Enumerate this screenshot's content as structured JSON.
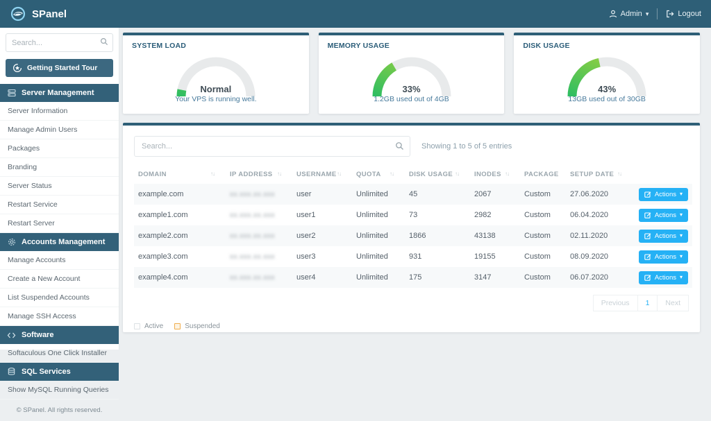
{
  "topbar": {
    "brand": "SPanel",
    "admin_label": "Admin",
    "logout_label": "Logout"
  },
  "sidebar": {
    "search_placeholder": "Search...",
    "tour_button_label": "Getting Started Tour",
    "sections": [
      {
        "label": "Server Management",
        "icon": "server-icon",
        "items": [
          "Server Information",
          "Manage Admin Users",
          "Packages",
          "Branding",
          "Server Status",
          "Restart Service",
          "Restart Server"
        ]
      },
      {
        "label": "Accounts Management",
        "icon": "gear-icon",
        "items": [
          "Manage Accounts",
          "Create a New Account",
          "List Suspended Accounts",
          "Manage SSH Access"
        ]
      },
      {
        "label": "Software",
        "icon": "code-icon",
        "items": [
          "Softaculous One Click Installer"
        ]
      },
      {
        "label": "SQL Services",
        "icon": "database-icon",
        "items": [
          "Show MySQL Running Queries"
        ]
      }
    ],
    "footer": "© SPanel. All rights reserved."
  },
  "cards": [
    {
      "title": "SYSTEM LOAD",
      "center": "Normal",
      "sub": "Your VPS is running well.",
      "percent": 6
    },
    {
      "title": "MEMORY USAGE",
      "center": "33%",
      "sub": "1.2GB used out of 4GB",
      "percent": 33
    },
    {
      "title": "DISK USAGE",
      "center": "43%",
      "sub": "13GB used out of 30GB",
      "percent": 43
    }
  ],
  "chart_data": [
    {
      "type": "gauge",
      "title": "SYSTEM LOAD",
      "value_label": "Normal",
      "subtitle": "Your VPS is running well.",
      "percent": 6
    },
    {
      "type": "gauge",
      "title": "MEMORY USAGE",
      "value_label": "33%",
      "subtitle": "1.2GB used out of 4GB",
      "percent": 33
    },
    {
      "type": "gauge",
      "title": "DISK USAGE",
      "value_label": "43%",
      "subtitle": "13GB used out of 30GB",
      "percent": 43
    }
  ],
  "table": {
    "search_placeholder": "Search...",
    "showing_text": "Showing 1 to 5 of 5 entries",
    "actions_label": "Actions",
    "columns": [
      {
        "label": "DOMAIN",
        "sortable": true,
        "width": 132
      },
      {
        "label": "IP ADDRESS",
        "sortable": true,
        "width": 96
      },
      {
        "label": "USERNAME",
        "sortable": true,
        "width": 86
      },
      {
        "label": "QUOTA",
        "sortable": true,
        "width": 76
      },
      {
        "label": "DISK USAGE",
        "sortable": true,
        "width": 94
      },
      {
        "label": "INODES",
        "sortable": true,
        "width": 72
      },
      {
        "label": "PACKAGE",
        "sortable": false,
        "width": 66
      },
      {
        "label": "SETUP DATE",
        "sortable": true,
        "width": 96
      },
      {
        "label": "",
        "sortable": false,
        "width": 86
      }
    ],
    "rows": [
      {
        "domain": "example.com",
        "ip_masked": "xx.xxx.xx.xxx",
        "username": "user",
        "quota": "Unlimited",
        "disk_usage": "45",
        "inodes": "2067",
        "package": "Custom",
        "setup_date": "27.06.2020"
      },
      {
        "domain": "example1.com",
        "ip_masked": "xx.xxx.xx.xxx",
        "username": "user1",
        "quota": "Unlimited",
        "disk_usage": "73",
        "inodes": "2982",
        "package": "Custom",
        "setup_date": "06.04.2020"
      },
      {
        "domain": "example2.com",
        "ip_masked": "xx.xxx.xx.xxx",
        "username": "user2",
        "quota": "Unlimited",
        "disk_usage": "1866",
        "inodes": "43138",
        "package": "Custom",
        "setup_date": "02.11.2020"
      },
      {
        "domain": "example3.com",
        "ip_masked": "xx.xxx.xx.xxx",
        "username": "user3",
        "quota": "Unlimited",
        "disk_usage": "931",
        "inodes": "19155",
        "package": "Custom",
        "setup_date": "08.09.2020"
      },
      {
        "domain": "example4.com",
        "ip_masked": "xx.xxx.xx.xxx",
        "username": "user4",
        "quota": "Unlimited",
        "disk_usage": "175",
        "inodes": "3147",
        "package": "Custom",
        "setup_date": "06.07.2020"
      }
    ],
    "pagination": {
      "previous": "Previous",
      "page": "1",
      "next": "Next"
    },
    "legend": [
      {
        "label": "Active",
        "type": "active"
      },
      {
        "label": "Suspended",
        "type": "suspended"
      }
    ]
  },
  "colors": {
    "topbar": "#2e5f77",
    "section_header": "#336179",
    "accent_blue": "#25b1f5",
    "gauge_green_start": "#2fbe62",
    "gauge_green_end": "#9ed13c",
    "gauge_track": "#e8eaeb"
  }
}
